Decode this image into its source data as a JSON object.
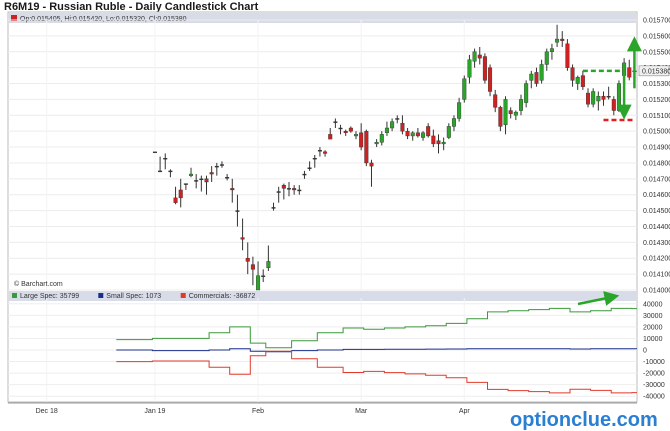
{
  "title": "R6M19 - Russian Ruble - Daily Candlestick Chart",
  "ohlc_label": "Op:0.015405, Hi:0.015420, Lo:0.015320, Cl:0.015380",
  "copyright": "© Barchart.com",
  "watermark": "optionclue.com",
  "colors": {
    "up": "#2aa52a",
    "down": "#cc2222",
    "neutral": "#333333",
    "large_spec": "#3a9a3a",
    "small_spec": "#1a2f8a",
    "commercials": "#e23a2a",
    "arrow": "#2aa52a",
    "dash_red": "#e02020",
    "legend_band": "#d8dce8",
    "last_price_box": "#f0f0f0"
  },
  "chart_data": [
    {
      "type": "candlestick",
      "title": "R6M19 - Russian Ruble - Daily Candlestick Chart",
      "ylim": [
        0.014,
        0.0157
      ],
      "y_ticks": [
        "0.015700",
        "0.015600",
        "0.015500",
        "0.015400",
        "0.015300",
        "0.015200",
        "0.015100",
        "0.015000",
        "0.014900",
        "0.014800",
        "0.014700",
        "0.014600",
        "0.014500",
        "0.014400",
        "0.014300",
        "0.014200",
        "0.014100",
        "0.014000"
      ],
      "last_price": "0.015380",
      "x_labels": [
        "Dec 18",
        "Jan 19",
        "Feb",
        "Mar",
        "Apr"
      ],
      "x_label_index": [
        7,
        28,
        48,
        68,
        88
      ],
      "total_slots": 122,
      "candles": [
        {
          "o": 0.01487,
          "h": 0.01487,
          "l": 0.01487,
          "c": 0.01487
        },
        {
          "o": 0.01475,
          "h": 0.01484,
          "l": 0.01475,
          "c": 0.01475
        },
        {
          "o": 0.01483,
          "h": 0.01486,
          "l": 0.01476,
          "c": 0.01483
        },
        {
          "o": 0.01475,
          "h": 0.01476,
          "l": 0.01471,
          "c": 0.01475
        },
        {
          "o": 0.01458,
          "h": 0.01465,
          "l": 0.01454,
          "c": 0.01455
        },
        {
          "o": 0.01463,
          "h": 0.0147,
          "l": 0.01452,
          "c": 0.01458
        },
        {
          "o": 0.01467,
          "h": 0.01467,
          "l": 0.01463,
          "c": 0.01467
        },
        {
          "o": 0.01472,
          "h": 0.01477,
          "l": 0.01471,
          "c": 0.01473
        },
        {
          "o": 0.01469,
          "h": 0.01473,
          "l": 0.01464,
          "c": 0.01469
        },
        {
          "o": 0.0147,
          "h": 0.01472,
          "l": 0.01462,
          "c": 0.0147
        },
        {
          "o": 0.0147,
          "h": 0.01472,
          "l": 0.0146,
          "c": 0.01468
        },
        {
          "o": 0.01474,
          "h": 0.01478,
          "l": 0.01468,
          "c": 0.01473
        },
        {
          "o": 0.01478,
          "h": 0.0148,
          "l": 0.01472,
          "c": 0.01478
        },
        {
          "o": 0.01479,
          "h": 0.01481,
          "l": 0.01477,
          "c": 0.01479
        },
        {
          "o": 0.01471,
          "h": 0.01473,
          "l": 0.01469,
          "c": 0.01471
        },
        {
          "o": 0.01464,
          "h": 0.0147,
          "l": 0.01455,
          "c": 0.01463
        },
        {
          "o": 0.0145,
          "h": 0.0146,
          "l": 0.0144,
          "c": 0.0145
        },
        {
          "o": 0.01433,
          "h": 0.01445,
          "l": 0.01425,
          "c": 0.01432
        },
        {
          "o": 0.0142,
          "h": 0.0143,
          "l": 0.0141,
          "c": 0.01418
        },
        {
          "o": 0.01416,
          "h": 0.01421,
          "l": 0.01403,
          "c": 0.01413
        },
        {
          "o": 0.014,
          "h": 0.01418,
          "l": 0.014,
          "c": 0.01409
        },
        {
          "o": 0.01409,
          "h": 0.01413,
          "l": 0.01405,
          "c": 0.01409
        },
        {
          "o": 0.01414,
          "h": 0.01428,
          "l": 0.01412,
          "c": 0.01418
        },
        {
          "o": 0.01452,
          "h": 0.01455,
          "l": 0.0145,
          "c": 0.01452
        },
        {
          "o": 0.01462,
          "h": 0.01465,
          "l": 0.01455,
          "c": 0.01462
        },
        {
          "o": 0.01466,
          "h": 0.01467,
          "l": 0.01457,
          "c": 0.01464
        },
        {
          "o": 0.01464,
          "h": 0.01468,
          "l": 0.01459,
          "c": 0.01464
        },
        {
          "o": 0.01464,
          "h": 0.01466,
          "l": 0.0146,
          "c": 0.01463
        },
        {
          "o": 0.01463,
          "h": 0.01466,
          "l": 0.0146,
          "c": 0.01463
        },
        {
          "o": 0.01473,
          "h": 0.01475,
          "l": 0.0147,
          "c": 0.01473
        },
        {
          "o": 0.01477,
          "h": 0.01481,
          "l": 0.01475,
          "c": 0.01477
        },
        {
          "o": 0.01483,
          "h": 0.01485,
          "l": 0.01477,
          "c": 0.01483
        },
        {
          "o": 0.01488,
          "h": 0.0149,
          "l": 0.01484,
          "c": 0.01488
        },
        {
          "o": 0.01487,
          "h": 0.01488,
          "l": 0.01484,
          "c": 0.01486
        },
        {
          "o": 0.01498,
          "h": 0.01502,
          "l": 0.01496,
          "c": 0.01495
        },
        {
          "o": 0.01506,
          "h": 0.01508,
          "l": 0.01502,
          "c": 0.01506
        },
        {
          "o": 0.01502,
          "h": 0.01504,
          "l": 0.01498,
          "c": 0.01502
        },
        {
          "o": 0.015,
          "h": 0.01501,
          "l": 0.01497,
          "c": 0.01499
        },
        {
          "o": 0.01502,
          "h": 0.01503,
          "l": 0.01499,
          "c": 0.015
        },
        {
          "o": 0.01497,
          "h": 0.015,
          "l": 0.01495,
          "c": 0.01498
        },
        {
          "o": 0.01499,
          "h": 0.01505,
          "l": 0.01488,
          "c": 0.0149
        },
        {
          "o": 0.015,
          "h": 0.01501,
          "l": 0.01478,
          "c": 0.0148
        },
        {
          "o": 0.0148,
          "h": 0.01482,
          "l": 0.01465,
          "c": 0.01478
        },
        {
          "o": 0.01492,
          "h": 0.01495,
          "l": 0.0149,
          "c": 0.01493
        },
        {
          "o": 0.01493,
          "h": 0.015,
          "l": 0.01491,
          "c": 0.01498
        },
        {
          "o": 0.01499,
          "h": 0.01506,
          "l": 0.01497,
          "c": 0.01502
        },
        {
          "o": 0.01502,
          "h": 0.01508,
          "l": 0.015,
          "c": 0.01506
        },
        {
          "o": 0.01508,
          "h": 0.0151,
          "l": 0.01505,
          "c": 0.01508
        },
        {
          "o": 0.01505,
          "h": 0.0151,
          "l": 0.01498,
          "c": 0.015
        },
        {
          "o": 0.015,
          "h": 0.01502,
          "l": 0.01495,
          "c": 0.01497
        },
        {
          "o": 0.01497,
          "h": 0.015,
          "l": 0.01494,
          "c": 0.01499
        },
        {
          "o": 0.01499,
          "h": 0.01502,
          "l": 0.01496,
          "c": 0.01497
        },
        {
          "o": 0.01496,
          "h": 0.015,
          "l": 0.01494,
          "c": 0.01499
        },
        {
          "o": 0.01503,
          "h": 0.01505,
          "l": 0.01496,
          "c": 0.01497
        },
        {
          "o": 0.01497,
          "h": 0.01501,
          "l": 0.0149,
          "c": 0.01492
        },
        {
          "o": 0.01494,
          "h": 0.01498,
          "l": 0.01486,
          "c": 0.01492
        },
        {
          "o": 0.01492,
          "h": 0.01496,
          "l": 0.01488,
          "c": 0.01493
        },
        {
          "o": 0.01496,
          "h": 0.01505,
          "l": 0.01495,
          "c": 0.01503
        },
        {
          "o": 0.01503,
          "h": 0.0151,
          "l": 0.015,
          "c": 0.01508
        },
        {
          "o": 0.01508,
          "h": 0.01521,
          "l": 0.01506,
          "c": 0.01518
        },
        {
          "o": 0.0152,
          "h": 0.01535,
          "l": 0.01518,
          "c": 0.01533
        },
        {
          "o": 0.01534,
          "h": 0.01548,
          "l": 0.0153,
          "c": 0.01545
        },
        {
          "o": 0.01544,
          "h": 0.01552,
          "l": 0.0154,
          "c": 0.0155
        },
        {
          "o": 0.01548,
          "h": 0.01553,
          "l": 0.01542,
          "c": 0.01546
        },
        {
          "o": 0.01547,
          "h": 0.01549,
          "l": 0.0153,
          "c": 0.01532
        },
        {
          "o": 0.0154,
          "h": 0.01542,
          "l": 0.01522,
          "c": 0.01525
        },
        {
          "o": 0.01523,
          "h": 0.01526,
          "l": 0.01512,
          "c": 0.01515
        },
        {
          "o": 0.01515,
          "h": 0.01516,
          "l": 0.015,
          "c": 0.01503
        },
        {
          "o": 0.01504,
          "h": 0.01522,
          "l": 0.01498,
          "c": 0.0152
        },
        {
          "o": 0.01513,
          "h": 0.01515,
          "l": 0.01508,
          "c": 0.01511
        },
        {
          "o": 0.0151,
          "h": 0.01513,
          "l": 0.01507,
          "c": 0.01512
        },
        {
          "o": 0.01513,
          "h": 0.01523,
          "l": 0.0151,
          "c": 0.0152
        },
        {
          "o": 0.01518,
          "h": 0.01532,
          "l": 0.01515,
          "c": 0.0153
        },
        {
          "o": 0.01532,
          "h": 0.01538,
          "l": 0.01527,
          "c": 0.01536
        },
        {
          "o": 0.01537,
          "h": 0.0154,
          "l": 0.01528,
          "c": 0.0153
        },
        {
          "o": 0.01532,
          "h": 0.01545,
          "l": 0.0153,
          "c": 0.01542
        },
        {
          "o": 0.01542,
          "h": 0.01552,
          "l": 0.01538,
          "c": 0.0155
        },
        {
          "o": 0.0155,
          "h": 0.01555,
          "l": 0.01545,
          "c": 0.01552
        },
        {
          "o": 0.01556,
          "h": 0.01567,
          "l": 0.01553,
          "c": 0.01558
        },
        {
          "o": 0.01558,
          "h": 0.01563,
          "l": 0.01553,
          "c": 0.01557
        },
        {
          "o": 0.01555,
          "h": 0.01558,
          "l": 0.01538,
          "c": 0.0154
        },
        {
          "o": 0.0154,
          "h": 0.01542,
          "l": 0.01528,
          "c": 0.01532
        },
        {
          "o": 0.0153,
          "h": 0.01535,
          "l": 0.01526,
          "c": 0.01534
        },
        {
          "o": 0.01535,
          "h": 0.01538,
          "l": 0.01526,
          "c": 0.01528
        },
        {
          "o": 0.01524,
          "h": 0.01527,
          "l": 0.01515,
          "c": 0.01517
        },
        {
          "o": 0.01517,
          "h": 0.01527,
          "l": 0.01515,
          "c": 0.01525
        },
        {
          "o": 0.01519,
          "h": 0.01525,
          "l": 0.01513,
          "c": 0.01522
        },
        {
          "o": 0.01522,
          "h": 0.01525,
          "l": 0.01516,
          "c": 0.0152
        },
        {
          "o": 0.01522,
          "h": 0.01528,
          "l": 0.0152,
          "c": 0.01522
        },
        {
          "o": 0.0152,
          "h": 0.01522,
          "l": 0.0151,
          "c": 0.01513
        },
        {
          "o": 0.01513,
          "h": 0.01532,
          "l": 0.01512,
          "c": 0.0153
        },
        {
          "o": 0.01535,
          "h": 0.01546,
          "l": 0.01533,
          "c": 0.01543
        },
        {
          "o": 0.0154,
          "h": 0.01545,
          "l": 0.01532,
          "c": 0.01534
        },
        {
          "o": 0.01538,
          "h": 0.01542,
          "l": 0.01532,
          "c": 0.01538
        }
      ],
      "annotations": {
        "arrow_up": {
          "x_index": 121,
          "from": 0.01527,
          "to": 0.01555
        },
        "arrow_down": {
          "x_index": 119,
          "from": 0.01538,
          "to": 0.01512
        },
        "dash_green": {
          "from_index": 111,
          "to_index": 119,
          "y": 0.01538
        },
        "dash_red": {
          "from_index": 115,
          "to_index": 121,
          "y": 0.01507
        }
      }
    },
    {
      "type": "line",
      "title": "",
      "ylim": [
        -45000,
        45000
      ],
      "y_ticks": [
        "40000",
        "30000",
        "20000",
        "10000",
        "0",
        "-10000",
        "-20000",
        "-30000",
        "-40000"
      ],
      "series": [
        {
          "name": "Large Spec: 35799",
          "color": "#3a9a3a",
          "values": [
            9000,
            9000,
            9000,
            9000,
            9000,
            9000,
            9000,
            10000,
            10000,
            10000,
            10000,
            10000,
            10000,
            10000,
            10000,
            10000,
            10000,
            10000,
            15000,
            15000,
            15000,
            15000,
            20000,
            20000,
            20000,
            20000,
            6000,
            6000,
            6000,
            2000,
            2000,
            2000,
            2000,
            2000,
            8000,
            8000,
            8000,
            8000,
            8000,
            15000,
            15000,
            15000,
            15000,
            15000,
            19000,
            19000,
            19000,
            19000,
            18000,
            18000,
            18000,
            18000,
            19000,
            19000,
            19000,
            19000,
            20000,
            20000,
            20000,
            20000,
            21000,
            21000,
            21000,
            21000,
            23000,
            23000,
            23000,
            23000,
            27000,
            27000,
            27000,
            27000,
            33000,
            33000,
            33000,
            33000,
            34000,
            34000,
            34000,
            34000,
            35000,
            35000,
            35000,
            35000,
            36000,
            36000,
            36000,
            36000,
            33000,
            33000,
            33000,
            33000,
            34000,
            34000,
            34000,
            34000,
            36000,
            36000,
            36000,
            36000,
            35799
          ]
        },
        {
          "name": "Small Spec: 1073",
          "color": "#1a2f8a",
          "values": [
            0,
            0,
            0,
            0,
            0,
            0,
            0,
            -500,
            -500,
            -500,
            -500,
            -500,
            -500,
            -500,
            -500,
            -500,
            -500,
            -500,
            0,
            0,
            0,
            0,
            1000,
            1000,
            1000,
            1000,
            -1000,
            -1000,
            -1000,
            -1500,
            -1500,
            -1500,
            -1500,
            -1500,
            -500,
            -500,
            -500,
            -500,
            -500,
            0,
            0,
            0,
            0,
            0,
            500,
            500,
            500,
            500,
            500,
            500,
            500,
            500,
            600,
            600,
            600,
            600,
            700,
            700,
            700,
            700,
            800,
            800,
            800,
            800,
            900,
            900,
            900,
            900,
            1000,
            1000,
            1000,
            1000,
            1100,
            1100,
            1100,
            1100,
            1100,
            1100,
            1100,
            1100,
            1000,
            1000,
            1000,
            1000,
            1100,
            1100,
            1100,
            1100,
            900,
            900,
            900,
            900,
            1000,
            1000,
            1000,
            1000,
            1100,
            1100,
            1100,
            1100,
            1073
          ]
        },
        {
          "name": "Commercials: -36872",
          "color": "#e23a2a",
          "values": [
            -10000,
            -10000,
            -10000,
            -10000,
            -10000,
            -10000,
            -10000,
            -9500,
            -9500,
            -9500,
            -9500,
            -9500,
            -9500,
            -9500,
            -9500,
            -9500,
            -9500,
            -9500,
            -15000,
            -15000,
            -15000,
            -15000,
            -21000,
            -21000,
            -21000,
            -21000,
            -5000,
            -5000,
            -5000,
            -1000,
            -1000,
            -1000,
            -1000,
            -1000,
            -7500,
            -7500,
            -7500,
            -7500,
            -7500,
            -15000,
            -15000,
            -15000,
            -15000,
            -15000,
            -19500,
            -19500,
            -19500,
            -19500,
            -18500,
            -18500,
            -18500,
            -18500,
            -19600,
            -19600,
            -19600,
            -19600,
            -20700,
            -20700,
            -20700,
            -20700,
            -21800,
            -21800,
            -21800,
            -21800,
            -24000,
            -24000,
            -24000,
            -24000,
            -28000,
            -28000,
            -28000,
            -28000,
            -34100,
            -34100,
            -34100,
            -34100,
            -35100,
            -35100,
            -35100,
            -35100,
            -36000,
            -36000,
            -36000,
            -36000,
            -37100,
            -37100,
            -37100,
            -37100,
            -33900,
            -33900,
            -33900,
            -33900,
            -35000,
            -35000,
            -35000,
            -35000,
            -37100,
            -37100,
            -37100,
            -37100,
            -36872
          ]
        }
      ]
    }
  ]
}
